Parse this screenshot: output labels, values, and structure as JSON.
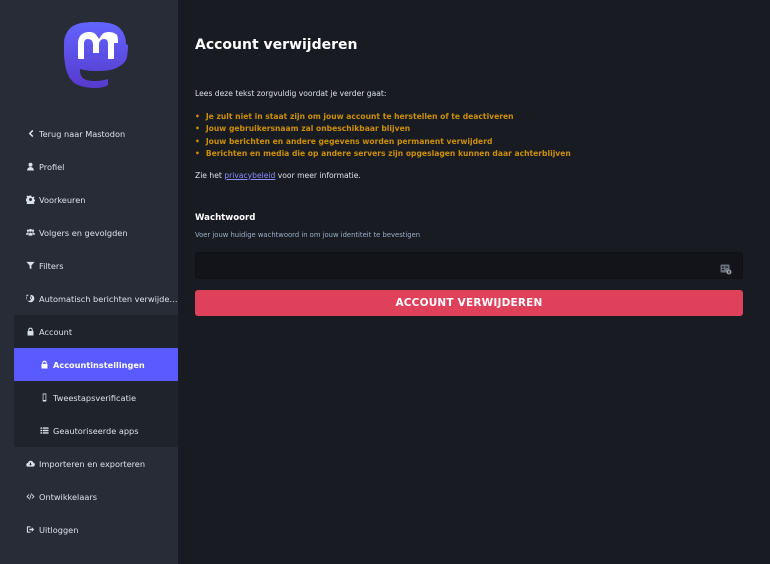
{
  "sidebar": {
    "items": [
      {
        "label": "Terug naar Mastodon",
        "icon": "chevron-left-icon"
      },
      {
        "label": "Profiel",
        "icon": "user-icon"
      },
      {
        "label": "Voorkeuren",
        "icon": "cog-icon"
      },
      {
        "label": "Volgers en gevolgden",
        "icon": "users-icon"
      },
      {
        "label": "Filters",
        "icon": "filter-icon"
      },
      {
        "label": "Automatisch berichten verwijderen",
        "icon": "history-icon"
      }
    ],
    "account_group": {
      "label": "Account",
      "icon": "lock-icon",
      "children": [
        {
          "label": "Accountinstellingen",
          "icon": "lock-icon",
          "active": true
        },
        {
          "label": "Tweestapsverificatie",
          "icon": "mobile-icon"
        },
        {
          "label": "Geautoriseerde apps",
          "icon": "list-icon"
        }
      ]
    },
    "bottom_items": [
      {
        "label": "Importeren en exporteren",
        "icon": "cloud-download-icon"
      },
      {
        "label": "Ontwikkelaars",
        "icon": "code-icon"
      },
      {
        "label": "Uitloggen",
        "icon": "sign-out-icon"
      }
    ]
  },
  "main": {
    "title": "Account verwijderen",
    "intro": "Lees deze tekst zorgvuldig voordat je verder gaat:",
    "warnings": [
      "Je zult niet in staat zijn om jouw account te herstellen of te deactiveren",
      "Jouw gebruikersnaam zal onbeschikbaar blijven",
      "Jouw berichten en andere gegevens worden permanent verwijderd",
      "Berichten en media die op andere servers zijn opgeslagen kunnen daar achterblijven"
    ],
    "policy_prefix": "Zie het",
    "policy_link": "privacybeleid",
    "policy_suffix": "voor meer informatie.",
    "password_label": "Wachtwoord",
    "password_hint": "Voer jouw huidige wachtwoord in om jouw identiteit te bevestigen",
    "password_value": "",
    "submit_label": "ACCOUNT VERWIJDEREN"
  },
  "colors": {
    "accent": "#595aff",
    "danger": "#df405a",
    "warning": "#ca8f04",
    "sidebar_bg": "#282c37",
    "page_bg": "#191b22"
  }
}
